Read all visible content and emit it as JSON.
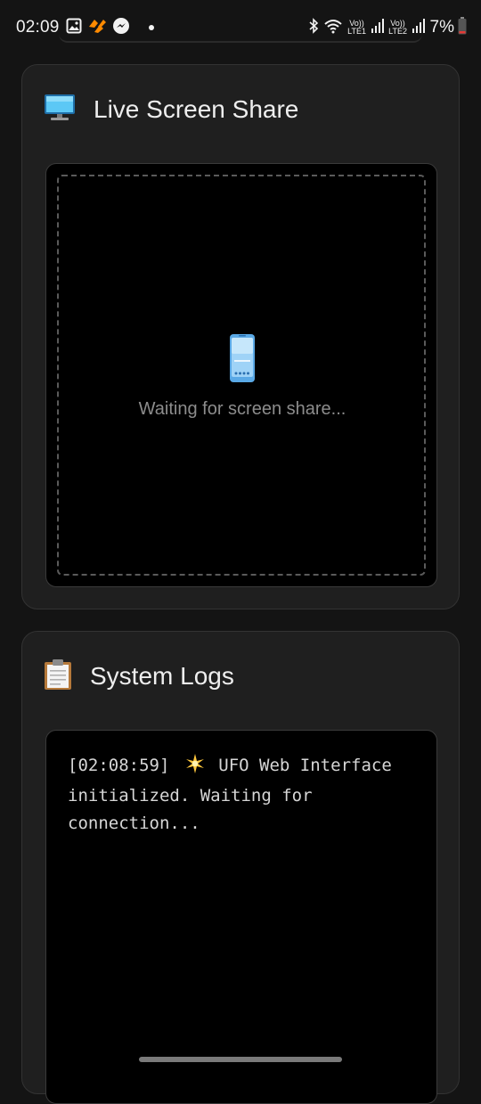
{
  "status_bar": {
    "time": "02:09",
    "left_icons": [
      "gallery-icon",
      "tinder-icon",
      "messenger-icon",
      "dot-icon"
    ],
    "sim1_label": "Vo)) LTE1",
    "sim2_label": "Vo)) LTE2",
    "battery_percent": "7%"
  },
  "screen_share": {
    "icon": "desktop-monitor-icon",
    "title": "Live Screen Share",
    "placeholder_icon": "mobile-phone-icon",
    "waiting_text": "Waiting for screen share..."
  },
  "system_logs": {
    "icon": "clipboard-icon",
    "title": "System Logs",
    "entries": [
      {
        "timestamp": "[02:08:59]",
        "icon": "sparkle-icon",
        "message": "UFO Web Interface initialized. Waiting for connection..."
      }
    ]
  },
  "colors": {
    "background": "#141414",
    "card": "#1f1f1f",
    "panel": "#000000",
    "text_muted": "#8c8c8c"
  }
}
